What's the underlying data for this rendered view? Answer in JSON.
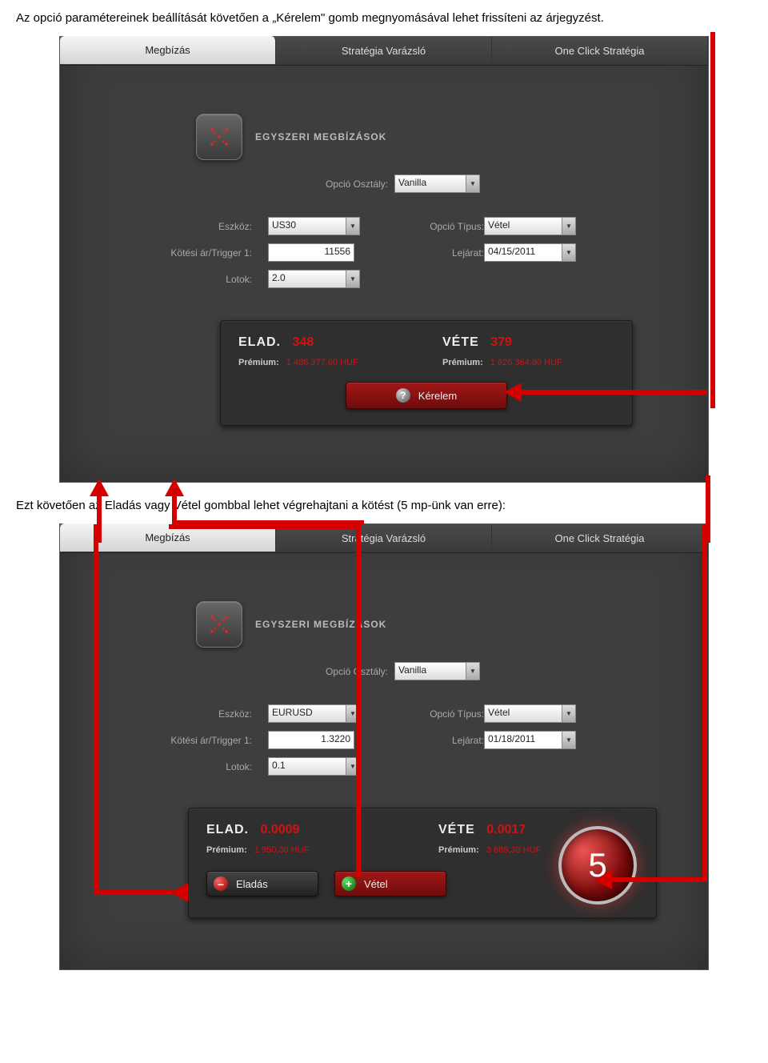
{
  "caption1": "Az opció paramétereinek beállítását követően a „Kérelem\" gomb megnyomásával lehet frissíteni az árjegyzést.",
  "caption2": "Ezt követően az Eladás vagy Vétel gombbal lehet végrehajtani a kötést (5 mp-ünk van erre):",
  "tabs": {
    "order": "Megbízás",
    "wizard": "Stratégia Varázsló",
    "oneclick": "One Click Stratégia"
  },
  "section_title": "EGYSZERI MEGBÍZÁSOK",
  "labels": {
    "option_class": "Opció Osztály:",
    "instrument": "Eszköz:",
    "option_type": "Opció Típus:",
    "strike": "Kötési ár/Trigger 1:",
    "expiry": "Lejárat:",
    "lots": "Lotok:"
  },
  "shot1": {
    "option_class": "Vanilla",
    "instrument": "US30",
    "option_type": "Vétel",
    "strike": "11556",
    "expiry": "04/15/2011",
    "lots": "2.0",
    "sell_label": "ELAD.",
    "sell_value": "348",
    "buy_label": "VÉTE",
    "buy_value": "379",
    "premium_label": "Prémium:",
    "sell_premium": "1 486 377,60 HUF",
    "buy_premium": "1 626 364,80 HUF",
    "request_label": "Kérelem"
  },
  "shot2": {
    "option_class": "Vanilla",
    "instrument": "EURUSD",
    "option_type": "Vétel",
    "strike": "1.3220",
    "expiry": "01/18/2011",
    "lots": "0.1",
    "sell_label": "ELAD.",
    "sell_value": "0.0009",
    "buy_label": "VÉTE",
    "buy_value": "0.0017",
    "premium_label": "Prémium:",
    "sell_premium": "1 950,30 HUF",
    "buy_premium": "3 689,30 HUF",
    "sell_btn": "Eladás",
    "buy_btn": "Vétel",
    "timer": "5"
  }
}
